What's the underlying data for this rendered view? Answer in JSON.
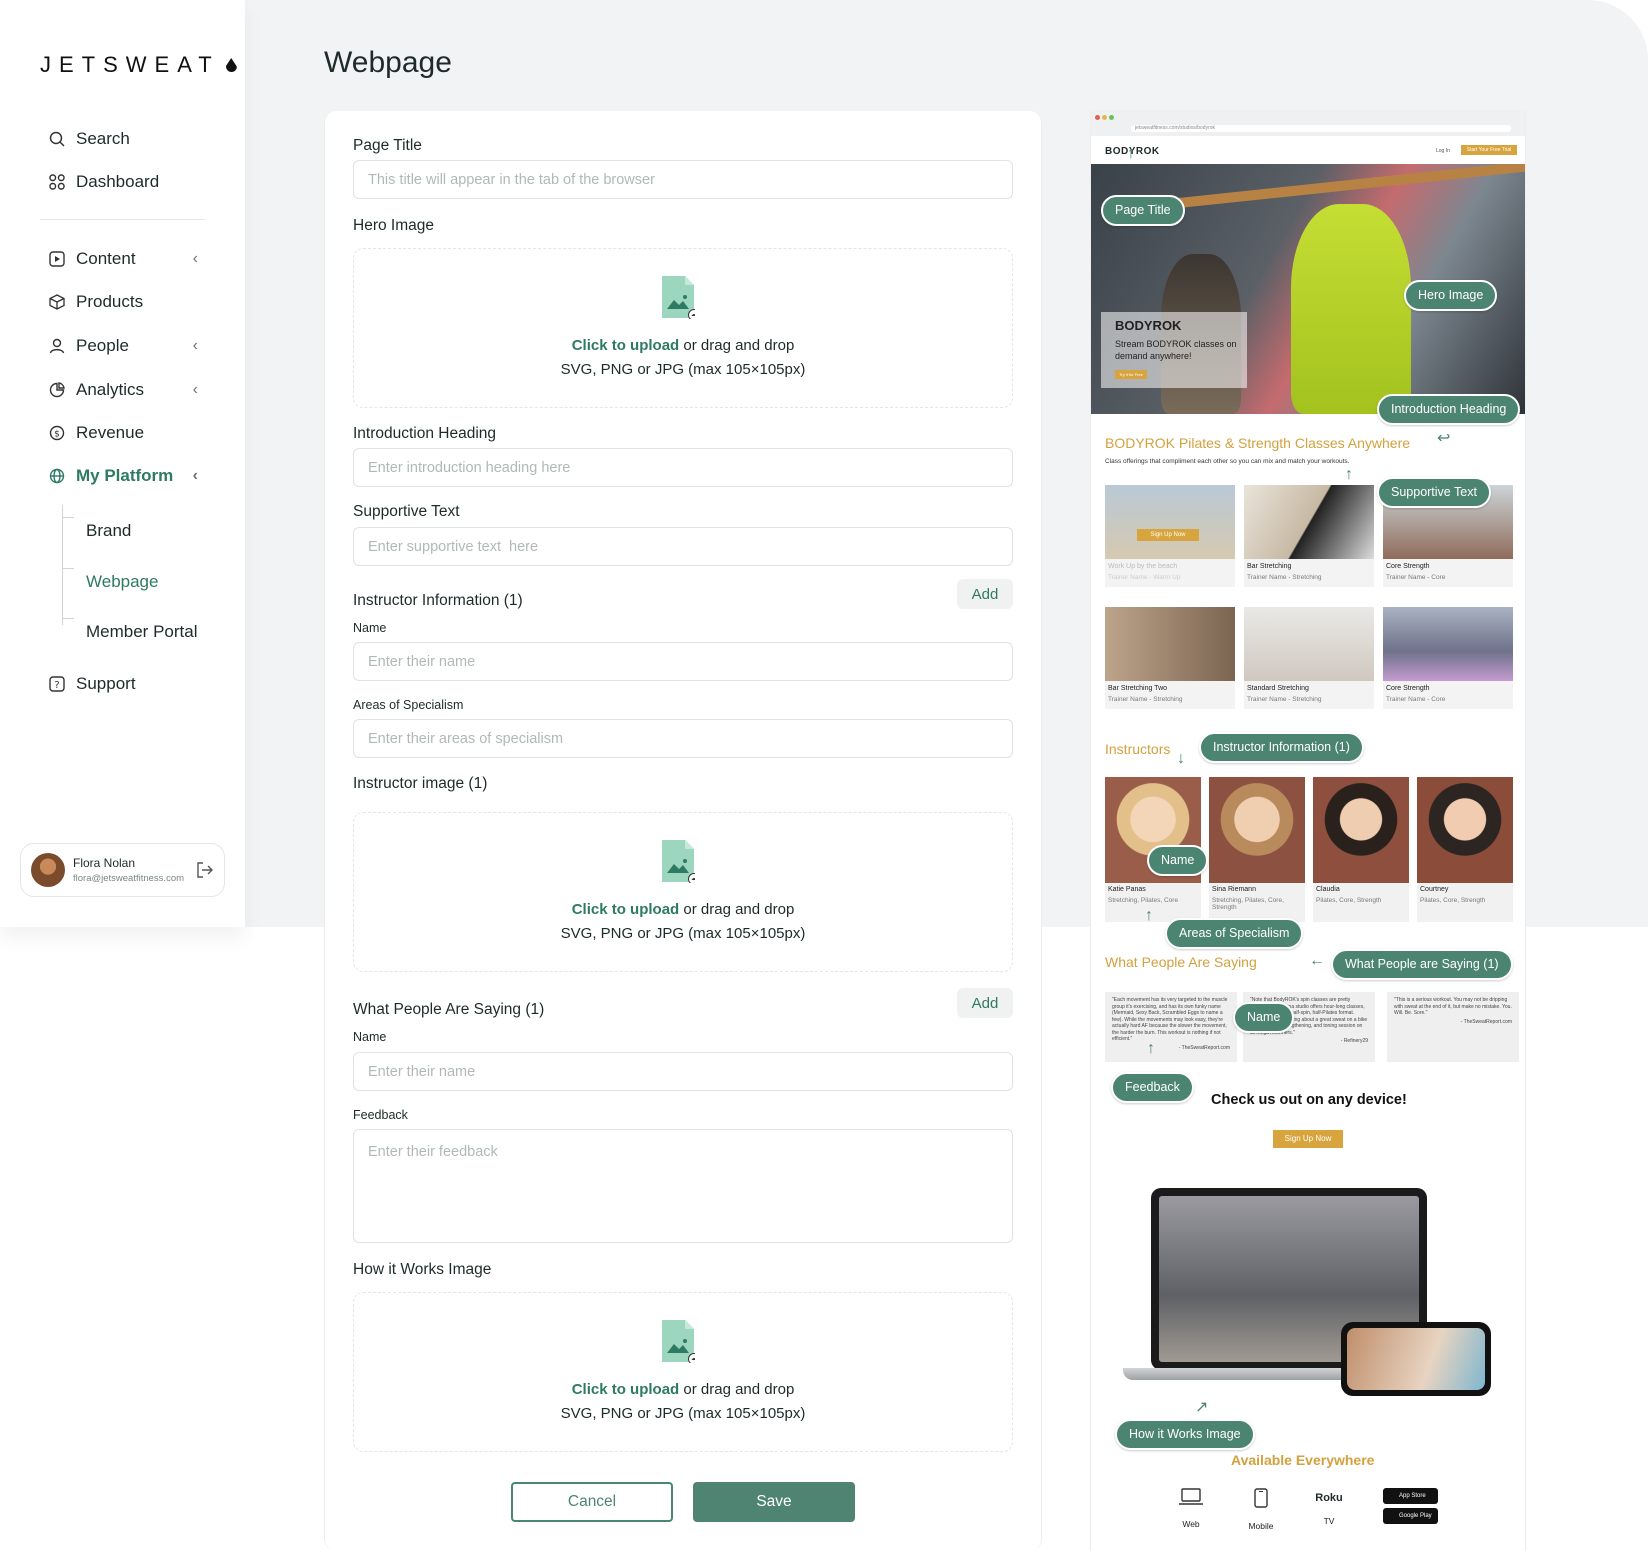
{
  "brand": {
    "name": "JETSWEAT"
  },
  "nav": {
    "items": [
      {
        "label": "Search",
        "icon": "search-icon"
      },
      {
        "label": "Dashboard",
        "icon": "grid-icon"
      },
      {
        "label": "Content",
        "icon": "play-square-icon",
        "expandable": true
      },
      {
        "label": "Products",
        "icon": "box-icon"
      },
      {
        "label": "People",
        "icon": "user-icon",
        "expandable": true
      },
      {
        "label": "Analytics",
        "icon": "pie-chart-icon",
        "expandable": true
      },
      {
        "label": "Revenue",
        "icon": "dollar-circle-icon"
      },
      {
        "label": "My Platform",
        "icon": "globe-icon",
        "expandable": true,
        "active": true
      },
      {
        "label": "Support",
        "icon": "help-square-icon"
      }
    ],
    "sub_items": [
      {
        "label": "Brand"
      },
      {
        "label": "Webpage",
        "active": true
      },
      {
        "label": "Member Portal"
      }
    ]
  },
  "user": {
    "name": "Flora Nolan",
    "email": "flora@jetsweatfitness.com"
  },
  "page": {
    "title": "Webpage"
  },
  "form": {
    "page_title_label": "Page Title",
    "page_title_placeholder": "This title will appear in the tab of the browser",
    "hero_image_label": "Hero Image",
    "upload_link": "Click to upload",
    "upload_rest": " or drag and drop",
    "upload_hint": "SVG, PNG or JPG (max 105×105px)",
    "intro_heading_label": "Introduction Heading",
    "intro_heading_placeholder": "Enter introduction heading here",
    "supportive_text_label": "Supportive Text",
    "supportive_text_placeholder": "Enter supportive text  here",
    "instructor_info_label": "Instructor Information (1)",
    "add_label": "Add",
    "name_label": "Name",
    "name_placeholder": "Enter their name",
    "specialism_label": "Areas of Specialism",
    "specialism_placeholder": "Enter their areas of specialism",
    "instructor_image_label": "Instructor image (1)",
    "testimonials_label": "What People Are Saying (1)",
    "feedback_label": "Feedback",
    "feedback_placeholder": "Enter their feedback",
    "how_it_works_label": "How it Works Image",
    "cancel_label": "Cancel",
    "save_label": "Save"
  },
  "preview": {
    "url": "jetsweatfitness.com/studios/bodyrok",
    "logo": "BODYROK",
    "login": "Log In",
    "cta": "Start Your Free Trial",
    "hero_title": "BODYROK",
    "hero_text": "Stream BODYROK classes on demand anywhere!",
    "hero_btn": "Try it for Free",
    "intro_heading": "BODYROK Pilates & Strength Classes Anywhere",
    "intro_sub": "Class offerings that compliment each other so you can mix and match your workouts.",
    "classes": [
      {
        "title": "Work Up by the beach",
        "sub": "Trainer Name - Warm Up",
        "overlay": "Sign Up Now"
      },
      {
        "title": "Bar Stretching",
        "sub": "Trainer Name - Stretching"
      },
      {
        "title": "Core Strength",
        "sub": "Trainer Name - Core"
      },
      {
        "title": "Bar Stretching Two",
        "sub": "Trainer Name - Stretching"
      },
      {
        "title": "Standard Stretching",
        "sub": "Trainer Name - Stretching"
      },
      {
        "title": "Core Strength",
        "sub": "Trainer Name - Core"
      }
    ],
    "instructors_heading": "Instructors",
    "instructors": [
      {
        "name": "Katie Panas",
        "spec": "Stretching, Pilates, Core"
      },
      {
        "name": "Sina Riemann",
        "spec": "Stretching, Pilates, Core, Strength"
      },
      {
        "name": "Claudia",
        "spec": "Pilates, Core, Strength"
      },
      {
        "name": "Courtney",
        "spec": "Pilates, Core, Strength"
      }
    ],
    "testimonials_heading": "What People Are Saying",
    "quotes": [
      {
        "text": "\"Each movement has its very targeted to the muscle group it's exercising, and has its own funky name (Mermaid, Sexy Back, Scrambled Eggs to name a few). While the movements may look easy, they're actually hard AF because the slower the movement, the harder the burn. This workout is nothing if not efficient.\"",
        "source": "- TheSweatReport.com"
      },
      {
        "text": "\"Note that BodyROK's spin classes are pretty intense. The Marina studio offers hour-long classes, which focus on its half-spin, half-Pilates format. There's just something about a great sweat on a bike followed by a strengthening, and toning session on its mega reformers.\"",
        "source": "- Refinery29"
      },
      {
        "text": "\"This is a serious workout. You may not be dripping with sweat at the end of it, but make no mistake. You. Will. Be. Sore.\"",
        "source": "- TheSweatReport.com"
      }
    ],
    "check_title": "Check us out on any device!",
    "signup": "Sign Up Now",
    "available": "Available Everywhere",
    "devices": [
      {
        "label": "Web",
        "icon": "laptop-icon"
      },
      {
        "label": "Mobile",
        "icon": "phone-icon"
      },
      {
        "label": "TV",
        "icon": "roku-icon",
        "brand": "Roku"
      }
    ],
    "stores": [
      "App Store",
      "Google Play"
    ]
  },
  "annotations": {
    "page_title": "Page Title",
    "hero_image": "Hero Image",
    "intro_heading": "Introduction Heading",
    "supportive_text": "Supportive Text",
    "instructor_info": "Instructor Information (1)",
    "name": "Name",
    "areas": "Areas of Specialism",
    "testimonials": "What People are Saying (1)",
    "name2": "Name",
    "feedback": "Feedback",
    "how_it_works": "How it Works Image"
  },
  "colors": {
    "accent": "#2f7a63",
    "button": "#4f8473",
    "gold": "#d3a13e",
    "background": "#f2f3f4"
  }
}
